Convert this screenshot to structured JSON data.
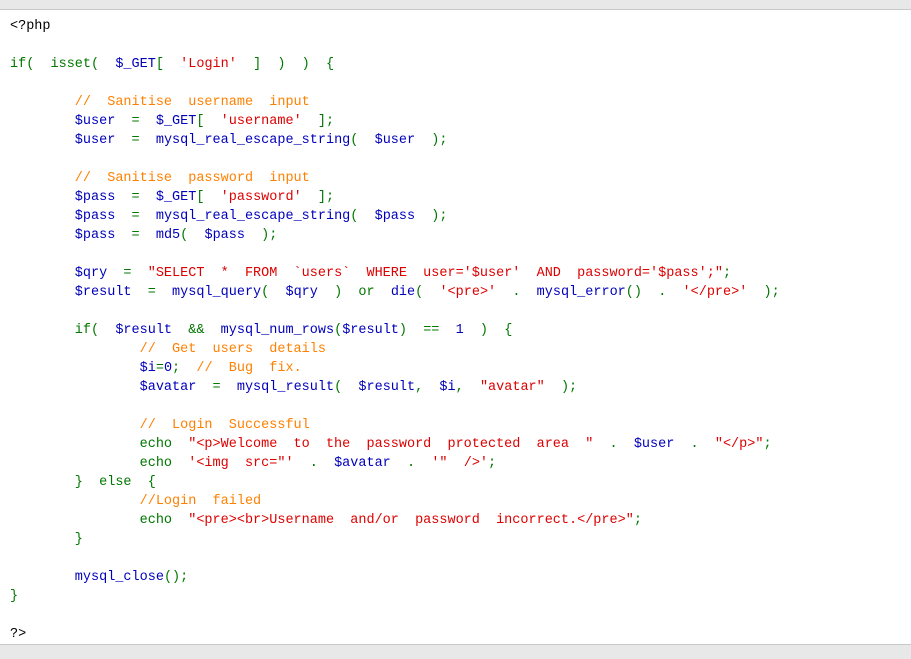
{
  "code": {
    "lines": [
      [
        {
          "t": "tag",
          "s": "<?php"
        }
      ],
      [],
      [
        {
          "t": "plain",
          "s": "if(  isset(  "
        },
        {
          "t": "var",
          "s": "$_GET"
        },
        {
          "t": "plain",
          "s": "[  "
        },
        {
          "t": "str",
          "s": "'Login'"
        },
        {
          "t": "plain",
          "s": "  ]  )  )  {"
        }
      ],
      [],
      [
        {
          "t": "cmt",
          "s": "        //  Sanitise  username  input"
        }
      ],
      [
        {
          "t": "var",
          "s": "        $user"
        },
        {
          "t": "plain",
          "s": "  =  "
        },
        {
          "t": "var",
          "s": "$_GET"
        },
        {
          "t": "plain",
          "s": "[  "
        },
        {
          "t": "str",
          "s": "'username'"
        },
        {
          "t": "plain",
          "s": "  ];"
        }
      ],
      [
        {
          "t": "var",
          "s": "        $user"
        },
        {
          "t": "plain",
          "s": "  =  "
        },
        {
          "t": "var",
          "s": "mysql_real_escape_string"
        },
        {
          "t": "plain",
          "s": "(  "
        },
        {
          "t": "var",
          "s": "$user"
        },
        {
          "t": "plain",
          "s": "  );"
        }
      ],
      [],
      [
        {
          "t": "cmt",
          "s": "        //  Sanitise  password  input"
        }
      ],
      [
        {
          "t": "var",
          "s": "        $pass"
        },
        {
          "t": "plain",
          "s": "  =  "
        },
        {
          "t": "var",
          "s": "$_GET"
        },
        {
          "t": "plain",
          "s": "[  "
        },
        {
          "t": "str",
          "s": "'password'"
        },
        {
          "t": "plain",
          "s": "  ];"
        }
      ],
      [
        {
          "t": "var",
          "s": "        $pass"
        },
        {
          "t": "plain",
          "s": "  =  "
        },
        {
          "t": "var",
          "s": "mysql_real_escape_string"
        },
        {
          "t": "plain",
          "s": "(  "
        },
        {
          "t": "var",
          "s": "$pass"
        },
        {
          "t": "plain",
          "s": "  );"
        }
      ],
      [
        {
          "t": "var",
          "s": "        $pass"
        },
        {
          "t": "plain",
          "s": "  =  "
        },
        {
          "t": "var",
          "s": "md5"
        },
        {
          "t": "plain",
          "s": "(  "
        },
        {
          "t": "var",
          "s": "$pass"
        },
        {
          "t": "plain",
          "s": "  );"
        }
      ],
      [],
      [
        {
          "t": "var",
          "s": "        $qry"
        },
        {
          "t": "plain",
          "s": "  =  "
        },
        {
          "t": "str",
          "s": "\"SELECT  *  FROM  `users`  WHERE  user='$user'  AND  password='$pass';\""
        },
        {
          "t": "plain",
          "s": ";"
        }
      ],
      [
        {
          "t": "var",
          "s": "        $result"
        },
        {
          "t": "plain",
          "s": "  =  "
        },
        {
          "t": "var",
          "s": "mysql_query"
        },
        {
          "t": "plain",
          "s": "(  "
        },
        {
          "t": "var",
          "s": "$qry"
        },
        {
          "t": "plain",
          "s": "  )  or  "
        },
        {
          "t": "var",
          "s": "die"
        },
        {
          "t": "plain",
          "s": "(  "
        },
        {
          "t": "str",
          "s": "'<pre>'"
        },
        {
          "t": "plain",
          "s": "  .  "
        },
        {
          "t": "var",
          "s": "mysql_error"
        },
        {
          "t": "plain",
          "s": "()  .  "
        },
        {
          "t": "str",
          "s": "'</pre>'"
        },
        {
          "t": "plain",
          "s": "  );"
        }
      ],
      [],
      [
        {
          "t": "plain",
          "s": "        if(  "
        },
        {
          "t": "var",
          "s": "$result"
        },
        {
          "t": "plain",
          "s": "  &&  "
        },
        {
          "t": "var",
          "s": "mysql_num_rows"
        },
        {
          "t": "plain",
          "s": "("
        },
        {
          "t": "var",
          "s": "$result"
        },
        {
          "t": "plain",
          "s": ")  ==  "
        },
        {
          "t": "var",
          "s": "1"
        },
        {
          "t": "plain",
          "s": "  )  {"
        }
      ],
      [
        {
          "t": "cmt",
          "s": "                //  Get  users  details"
        }
      ],
      [
        {
          "t": "var",
          "s": "                $i"
        },
        {
          "t": "plain",
          "s": "="
        },
        {
          "t": "var",
          "s": "0"
        },
        {
          "t": "plain",
          "s": ";  "
        },
        {
          "t": "cmt",
          "s": "//  Bug  fix."
        }
      ],
      [
        {
          "t": "var",
          "s": "                $avatar"
        },
        {
          "t": "plain",
          "s": "  =  "
        },
        {
          "t": "var",
          "s": "mysql_result"
        },
        {
          "t": "plain",
          "s": "(  "
        },
        {
          "t": "var",
          "s": "$result"
        },
        {
          "t": "plain",
          "s": ",  "
        },
        {
          "t": "var",
          "s": "$i"
        },
        {
          "t": "plain",
          "s": ",  "
        },
        {
          "t": "str",
          "s": "\"avatar\""
        },
        {
          "t": "plain",
          "s": "  );"
        }
      ],
      [],
      [
        {
          "t": "cmt",
          "s": "                //  Login  Successful"
        }
      ],
      [
        {
          "t": "plain",
          "s": "                echo  "
        },
        {
          "t": "str",
          "s": "\"<p>Welcome  to  the  password  protected  area  \""
        },
        {
          "t": "plain",
          "s": "  .  "
        },
        {
          "t": "var",
          "s": "$user"
        },
        {
          "t": "plain",
          "s": "  .  "
        },
        {
          "t": "str",
          "s": "\"</p>\""
        },
        {
          "t": "plain",
          "s": ";"
        }
      ],
      [
        {
          "t": "plain",
          "s": "                echo  "
        },
        {
          "t": "str",
          "s": "'<img  src=\"'"
        },
        {
          "t": "plain",
          "s": "  .  "
        },
        {
          "t": "var",
          "s": "$avatar"
        },
        {
          "t": "plain",
          "s": "  .  "
        },
        {
          "t": "str",
          "s": "'\"  />'"
        },
        {
          "t": "plain",
          "s": ";"
        }
      ],
      [
        {
          "t": "plain",
          "s": "        }  else  {"
        }
      ],
      [
        {
          "t": "cmt",
          "s": "                //Login  failed"
        }
      ],
      [
        {
          "t": "plain",
          "s": "                echo  "
        },
        {
          "t": "str",
          "s": "\"<pre><br>Username  and/or  password  incorrect.</pre>\""
        },
        {
          "t": "plain",
          "s": ";"
        }
      ],
      [
        {
          "t": "plain",
          "s": "        }"
        }
      ],
      [],
      [
        {
          "t": "var",
          "s": "        mysql_close"
        },
        {
          "t": "plain",
          "s": "();"
        }
      ],
      [
        {
          "t": "plain",
          "s": "}"
        }
      ],
      [],
      [
        {
          "t": "tag",
          "s": "?>"
        }
      ]
    ]
  },
  "colors": {
    "keyword": "#007700",
    "variable": "#0000bb",
    "string": "#dd0000",
    "comment": "#ff8000",
    "background": "#ffffff",
    "frame": "#e8e8e8"
  }
}
